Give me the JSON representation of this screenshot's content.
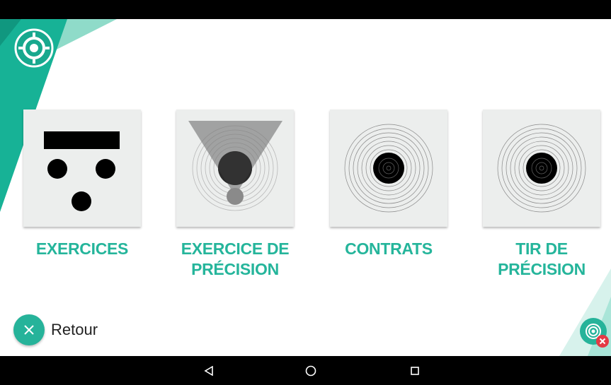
{
  "status_bar": {},
  "menu": {
    "items": [
      {
        "label": "EXERCICES"
      },
      {
        "label_line1": "EXERCICE DE",
        "label_line2": "PRÉCISION"
      },
      {
        "label": "CONTRATS"
      },
      {
        "label_line1": "TIR DE",
        "label_line2": "PRÉCISION"
      }
    ]
  },
  "footer": {
    "back_label": "Retour"
  },
  "colors": {
    "accent": "#25b59b",
    "accent_dark": "#1aa58b",
    "accent_light": "#7fd6c6",
    "card_bg": "#eceeed",
    "badge_red": "#e53945"
  },
  "icons": [
    "target-logo-icon",
    "close-icon",
    "target-remove-icon",
    "back-triangle-icon",
    "home-circle-icon",
    "recents-square-icon"
  ]
}
